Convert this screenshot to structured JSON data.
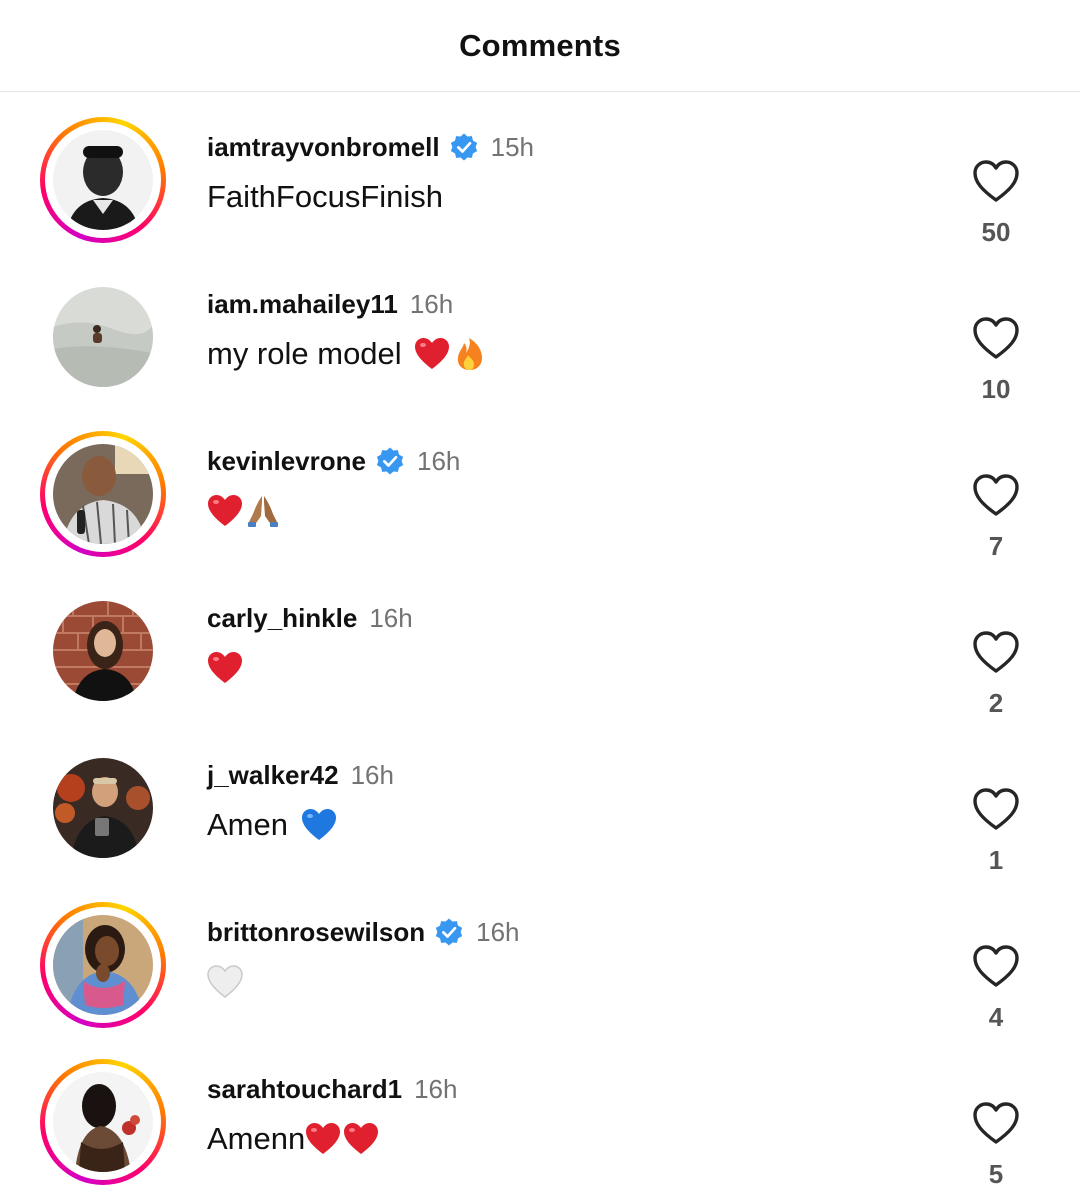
{
  "header": {
    "title": "Comments"
  },
  "colors": {
    "verified": "#3897f0",
    "time": "#737373",
    "heart_red": "#e0202e",
    "heart_blue": "#1f77e0",
    "heart_white": "#eeeeee"
  },
  "comments": [
    {
      "username": "iamtrayvonbromell",
      "verified": true,
      "time": "15h",
      "text": "FaithFocusFinish",
      "emojis": [],
      "likes": "50",
      "story_ring": true,
      "avatar": "man-portrait-avatar"
    },
    {
      "username": "iam.mahailey11",
      "verified": false,
      "time": "16h",
      "text": "my role model ",
      "emojis": [
        "red-heart",
        "fire"
      ],
      "likes": "10",
      "story_ring": false,
      "avatar": "beach-photo-avatar"
    },
    {
      "username": "kevinlevrone",
      "verified": true,
      "time": "16h",
      "text": "",
      "emojis": [
        "red-heart",
        "praying-hands"
      ],
      "likes": "7",
      "story_ring": true,
      "avatar": "man-with-microphone-avatar"
    },
    {
      "username": "carly_hinkle",
      "verified": false,
      "time": "16h",
      "text": "",
      "emojis": [
        "red-heart"
      ],
      "likes": "2",
      "story_ring": false,
      "avatar": "woman-brick-wall-avatar"
    },
    {
      "username": "j_walker42",
      "verified": false,
      "time": "16h",
      "text": "Amen ",
      "emojis": [
        "blue-heart"
      ],
      "likes": "1",
      "story_ring": false,
      "avatar": "man-selfie-avatar"
    },
    {
      "username": "brittonrosewilson",
      "verified": true,
      "time": "16h",
      "text": "",
      "emojis": [
        "white-heart"
      ],
      "likes": "4",
      "story_ring": true,
      "avatar": "woman-smiling-avatar"
    },
    {
      "username": "sarahtouchard1",
      "verified": false,
      "time": "16h",
      "text": "Amenn",
      "emojis": [
        "red-heart",
        "red-heart"
      ],
      "likes": "5",
      "story_ring": true,
      "avatar": "woman-back-avatar"
    }
  ]
}
